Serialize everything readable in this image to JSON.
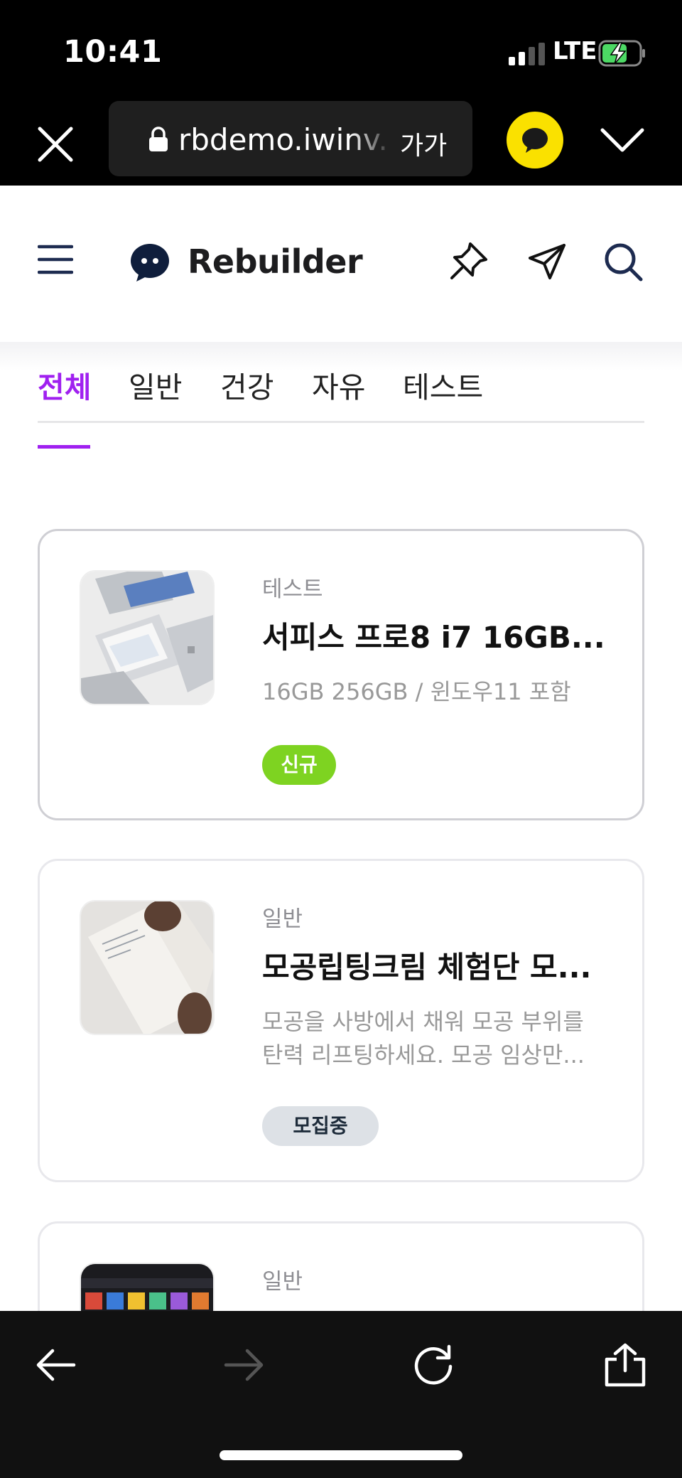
{
  "status_bar": {
    "time": "10:41",
    "network": "LTE"
  },
  "browser": {
    "url": "rbdemo.iwinv.",
    "text_size_label": "가가",
    "icons": {
      "close": "close-icon",
      "lock": "lock-icon",
      "kakao": "kakao-talk-icon",
      "expand": "chevron-down-icon"
    }
  },
  "site": {
    "logo_text": "Rebuilder",
    "icons": [
      "menu-icon",
      "pin-icon",
      "send-icon",
      "search-icon"
    ]
  },
  "tabs": [
    {
      "label": "전체",
      "active": true
    },
    {
      "label": "일반",
      "active": false
    },
    {
      "label": "건강",
      "active": false
    },
    {
      "label": "자유",
      "active": false
    },
    {
      "label": "테스트",
      "active": false
    }
  ],
  "posts": [
    {
      "category": "테스트",
      "title": "서피스 프로8 i7 16GB...",
      "description": "16GB 256GB / 윈도우11 포함",
      "badge": "신규",
      "thumbnail": "laptop-photo"
    },
    {
      "category": "일반",
      "title": "모공립팅크림 체험단 모...",
      "description": "모공을 사방에서 채워 모공 부위를 탄력 리프팅하세요. 모공 임상만...",
      "badge": "모집중",
      "thumbnail": "cream-tube-photo"
    },
    {
      "category": "일반",
      "title": "",
      "description": "",
      "badge": "",
      "thumbnail": "tv-screen-photo"
    }
  ],
  "colors": {
    "accent": "#a020f0",
    "badge_new": "#7ed321",
    "badge_recruit": "#dde1e6",
    "kakao_yellow": "#fae100"
  },
  "bottom_bar": {
    "icons": [
      "back-arrow-icon",
      "forward-arrow-icon",
      "reload-icon",
      "share-icon"
    ]
  }
}
